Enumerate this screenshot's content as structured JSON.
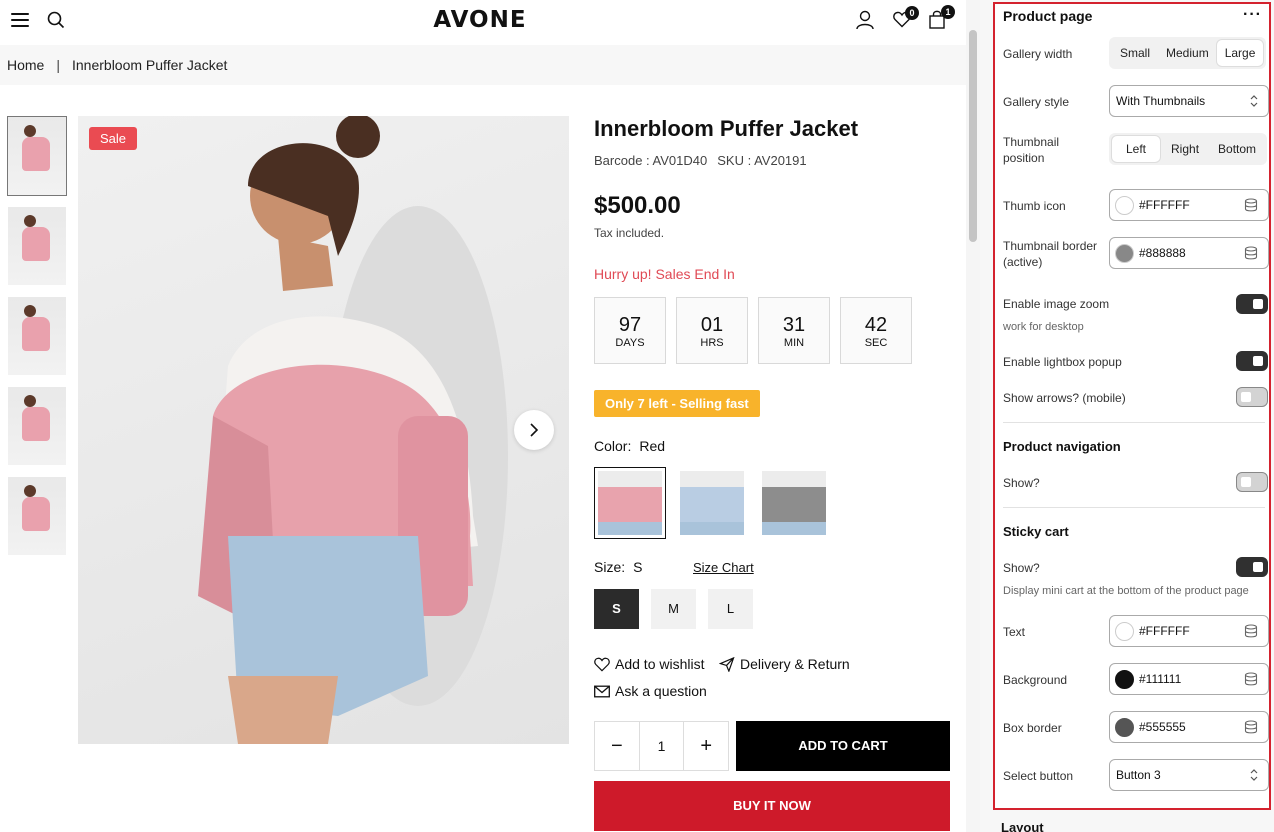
{
  "header": {
    "logo": "AVONE",
    "wishlist_count": "0",
    "cart_count": "1"
  },
  "breadcrumb": {
    "home": "Home",
    "separator": "|",
    "current": "Innerbloom Puffer Jacket"
  },
  "gallery": {
    "badge": "Sale"
  },
  "product": {
    "title": "Innerbloom Puffer Jacket",
    "barcode": "Barcode : AV01D40",
    "sku": "SKU : AV20191",
    "price": "$500.00",
    "tax_note": "Tax included.",
    "hurry_text": "Hurry up! Sales End In",
    "countdown": [
      {
        "value": "97",
        "unit": "DAYS"
      },
      {
        "value": "01",
        "unit": "HRS"
      },
      {
        "value": "31",
        "unit": "MIN"
      },
      {
        "value": "42",
        "unit": "SEC"
      }
    ],
    "stock_badge": "Only 7 left - Selling fast",
    "color_label": "Color:",
    "color_value": "Red",
    "size_label": "Size:",
    "size_value": "S",
    "size_chart": "Size Chart",
    "sizes": [
      "S",
      "M",
      "L"
    ],
    "wishlist_link": "Add to wishlist",
    "delivery_link": "Delivery & Return",
    "question_link": "Ask a question",
    "quantity": "1",
    "qty_minus": "−",
    "qty_plus": "+",
    "add_to_cart": "ADD TO CART",
    "buy_now": "BUY IT NOW"
  },
  "panel": {
    "title": "Product page",
    "menu_icon": "···",
    "gallery_width": {
      "label": "Gallery width",
      "options": [
        "Small",
        "Medium",
        "Large"
      ],
      "selected": "Large"
    },
    "gallery_style": {
      "label": "Gallery style",
      "value": "With Thumbnails"
    },
    "thumbnail_position": {
      "label": "Thumbnail position",
      "options": [
        "Left",
        "Right",
        "Bottom"
      ],
      "selected": "Left"
    },
    "thumb_icon": {
      "label": "Thumb icon",
      "value": "#FFFFFF",
      "color": "#FFFFFF"
    },
    "thumbnail_border": {
      "label": "Thumbnail border (active)",
      "value": "#888888",
      "color": "#888888"
    },
    "image_zoom": {
      "label": "Enable image zoom",
      "hint": "work for desktop",
      "enabled": true
    },
    "lightbox": {
      "label": "Enable lightbox popup",
      "enabled": true
    },
    "arrows_mobile": {
      "label": "Show arrows? (mobile)",
      "enabled": false
    },
    "product_navigation": {
      "title": "Product navigation",
      "show_label": "Show?",
      "enabled": false
    },
    "sticky_cart": {
      "title": "Sticky cart",
      "show_label": "Show?",
      "enabled": true,
      "hint": "Display mini cart at the bottom of the product page",
      "text": {
        "label": "Text",
        "value": "#FFFFFF",
        "color": "#FFFFFF"
      },
      "background": {
        "label": "Background",
        "value": "#111111",
        "color": "#111111"
      },
      "box_border": {
        "label": "Box border",
        "value": "#555555",
        "color": "#555555"
      },
      "select_button": {
        "label": "Select button",
        "value": "Button 3"
      }
    },
    "next_section": "Layout"
  },
  "colors": {
    "accent_red": "#ce1a2a",
    "sale_badge": "#ea4b52",
    "hurry_text": "#e04a55",
    "stock_badge": "#f8b32b",
    "panel_highlight": "#d4222e"
  }
}
